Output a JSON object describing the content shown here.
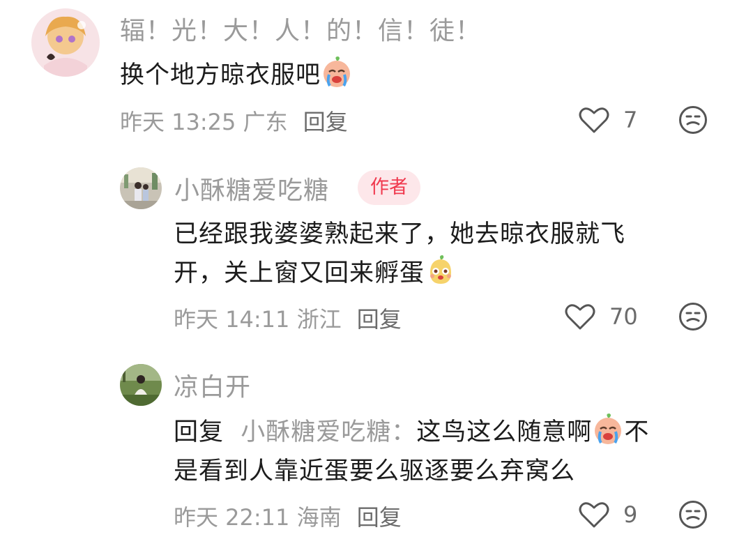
{
  "comments": [
    {
      "username": "辐！光！大！人！的！信！徒！",
      "text": "换个地方晾衣服吧",
      "emoji": "crying-face-emoji",
      "time": "昨天 13:25",
      "location": "广东",
      "reply_label": "回复",
      "likes": "7"
    },
    {
      "username": "小酥糖爱吃糖",
      "badge": "作者",
      "text_line1": "已经跟我婆婆熟起来了，她去晾衣服就飞",
      "text_line2": "开，关上窗又回来孵蛋",
      "emoji": "happy-face-emoji",
      "time": "昨天 14:11",
      "location": "浙江",
      "reply_label": "回复",
      "likes": "70"
    },
    {
      "username": "凉白开",
      "reply_prefix": "回复",
      "reply_target": "小酥糖爱吃糖：",
      "text_part1": "这鸟这么随意啊",
      "text_part2": "不",
      "text_line2": "是看到人靠近蛋要么驱逐要么弃窝么",
      "emoji": "crying-face-emoji",
      "time": "昨天 22:11",
      "location": "海南",
      "reply_label": "回复",
      "likes": "9"
    }
  ],
  "colors": {
    "badge_bg": "#fde7ea",
    "badge_text": "#f0394e",
    "meta_text": "#9a9a9a",
    "body_text": "#1c1c1c"
  },
  "icons": {
    "like": "heart-outline-icon",
    "dislike": "meh-face-icon"
  }
}
